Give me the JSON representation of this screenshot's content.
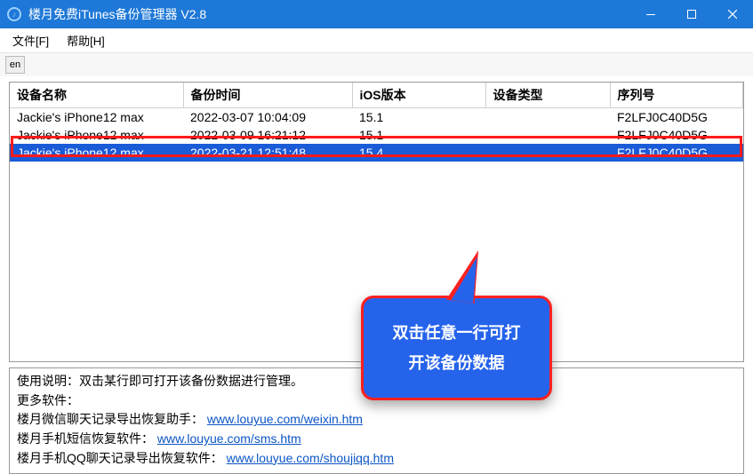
{
  "window": {
    "title": "楼月免费iTunes备份管理器 V2.8"
  },
  "menu": {
    "file": "文件[F]",
    "help": "帮助[H]"
  },
  "columns": {
    "name": "设备名称",
    "time": "备份时间",
    "ios": "iOS版本",
    "type": "设备类型",
    "serial": "序列号"
  },
  "rows": [
    {
      "name": "Jackie's iPhone12 max",
      "time": "2022-03-07 10:04:09",
      "ios": "15.1",
      "type": "",
      "serial": "F2LFJ0C40D5G",
      "selected": false
    },
    {
      "name": "Jackie's iPhone12 max",
      "time": "2022-03-09 16:21:12",
      "ios": "15.1",
      "type": "",
      "serial": "F2LFJ0C40D5G",
      "selected": false
    },
    {
      "name": "Jackie's iPhone12 max",
      "time": "2022-03-21 12:51:48",
      "ios": "15.4",
      "type": "",
      "serial": "F2LFJ0C40D5G",
      "selected": true
    }
  ],
  "callout": {
    "line1": "双击任意一行可打",
    "line2": "开该备份数据"
  },
  "info": {
    "line1_prefix": "使用说明：双击某行即可打开该备份数据进行管理。",
    "line2": "更多软件：",
    "line3_label": "楼月微信聊天记录导出恢复助手：",
    "line3_url": "www.louyue.com/weixin.htm",
    "line4_label": "楼月手机短信恢复软件：",
    "line4_url": "www.louyue.com/sms.htm",
    "line5_label": "楼月手机QQ聊天记录导出恢复软件：",
    "line5_url": "www.louyue.com/shoujiqq.htm"
  }
}
